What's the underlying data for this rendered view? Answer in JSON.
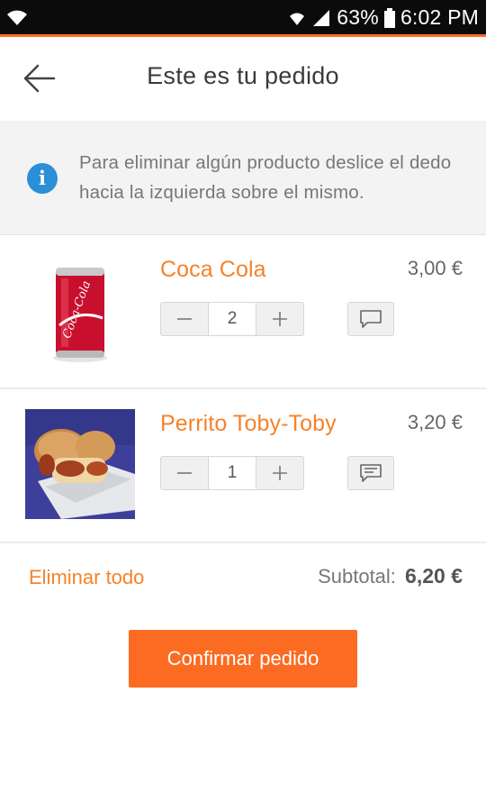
{
  "status_bar": {
    "battery": "63%",
    "time": "6:02 PM"
  },
  "header": {
    "title": "Este es tu pedido"
  },
  "info_banner": {
    "text": "Para eliminar algún producto deslice el dedo hacia la izquierda sobre el mismo."
  },
  "items": [
    {
      "name": "Coca Cola",
      "price": "3,00 €",
      "quantity": "2",
      "image": "coca-cola-can"
    },
    {
      "name": "Perrito Toby-Toby",
      "price": "3,20 €",
      "quantity": "1",
      "image": "hot-dog"
    }
  ],
  "footer": {
    "delete_all_label": "Eliminar todo",
    "subtotal_label": "Subtotal:",
    "subtotal_value": "6,20 €",
    "confirm_label": "Confirmar pedido"
  },
  "colors": {
    "accent": "#f5822a",
    "button": "#fb6b22",
    "info": "#2b8fd8"
  }
}
